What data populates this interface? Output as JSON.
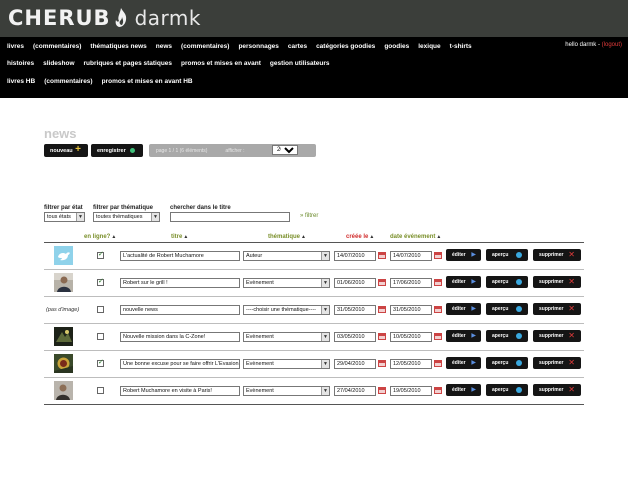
{
  "header": {
    "logo_text": "CHERUB",
    "site_name": "darmk",
    "greeting": "hello darmk -",
    "logout_label": "(logout)"
  },
  "nav": {
    "row1": [
      "livres",
      "(commentaires)",
      "thématiques news",
      "news",
      "(commentaires)",
      "personnages",
      "cartes",
      "catégories goodies",
      "goodies",
      "lexique",
      "t-shirts"
    ],
    "row2": [
      "histoires",
      "slideshow",
      "rubriques et pages statiques",
      "promos et mises en avant",
      "gestion utilisateurs"
    ],
    "row3": [
      "livres HB",
      "(commentaires)",
      "promos et mises en avant HB"
    ]
  },
  "page": {
    "title": "news"
  },
  "toolbar": {
    "new_label": "nouveau",
    "save_label": "enregistrer",
    "page_info": "page 1 / 1  (6 éléments)",
    "show_label": "afficher :",
    "per_page": "20"
  },
  "filters": {
    "state_label": "filtrer par état",
    "state_value": "tous états",
    "theme_label": "filtrer par thématique",
    "theme_value": "toutes thématiques",
    "search_label": "chercher dans le titre",
    "search_value": "",
    "submit_label": "» filtrer"
  },
  "table": {
    "headers": {
      "online": "en ligne?",
      "title": "titre",
      "theme": "thématique",
      "created": "créée le",
      "event": "date événement"
    },
    "sort_marker": "▲",
    "no_image_label": "(pas d'image)",
    "actions": {
      "edit": "éditer",
      "preview": "aperçu",
      "delete": "supprimer"
    },
    "rows": [
      {
        "image": "twitter-bird",
        "online": true,
        "title": "L'actualité de Robert Muchamore",
        "theme": "Auteur",
        "created": "14/07/2010",
        "event": "14/07/2010"
      },
      {
        "image": "photo-person",
        "online": true,
        "title": "Robert sur le grill !",
        "theme": "Evènement",
        "created": "01/06/2010",
        "event": "17/06/2010"
      },
      {
        "image": "none",
        "online": false,
        "title": "nouvelle news",
        "theme": "----choisir une thématique----",
        "created": "31/05/2010",
        "event": "31/05/2010"
      },
      {
        "image": "photo-dark",
        "online": false,
        "title": "Nouvelle mission dans la C-Zone!",
        "theme": "Evènement",
        "created": "03/05/2010",
        "event": "10/05/2010"
      },
      {
        "image": "photo-badge",
        "online": true,
        "title": "Une bonne excuse pour se faire offrir L'Evasion",
        "theme": "Evènement",
        "created": "29/04/2010",
        "event": "12/05/2010"
      },
      {
        "image": "photo-person",
        "online": false,
        "title": "Robert Muchamore en visite à Paris!",
        "theme": "Evènement",
        "created": "27/04/2010",
        "event": "19/05/2010"
      }
    ]
  },
  "colors": {
    "header_bg": "#3b3e3a",
    "nav_bg": "#000000",
    "accent_green": "#7a8f2a",
    "sort_active": "#d12d2d",
    "logout": "#e23b3b"
  }
}
